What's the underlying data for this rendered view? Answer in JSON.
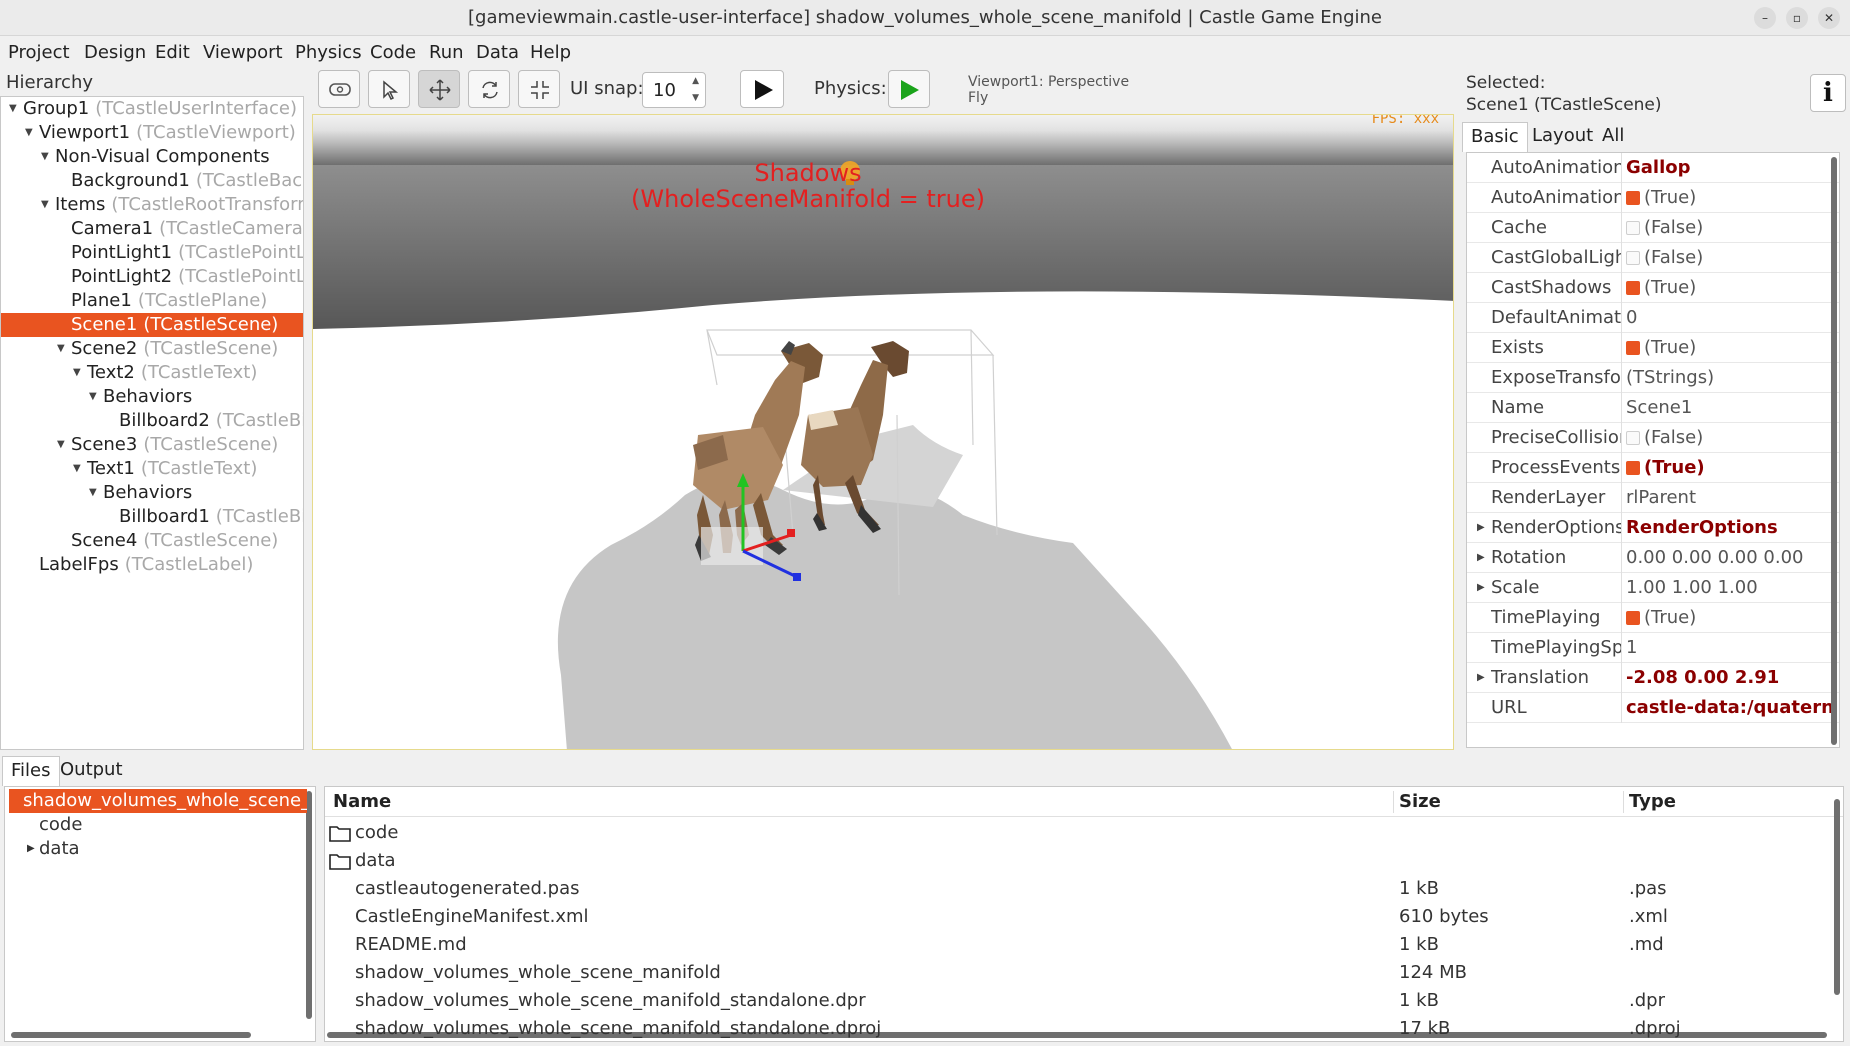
{
  "window": {
    "title": "[gameviewmain.castle-user-interface] shadow_volumes_whole_scene_manifold | Castle Game Engine",
    "btn_min": "–",
    "btn_max": "▫",
    "btn_close": "✕"
  },
  "menu": [
    "Project",
    "Design",
    "Edit",
    "Viewport",
    "Physics",
    "Code",
    "Run",
    "Data",
    "Help"
  ],
  "hierarchy": {
    "label": "Hierarchy",
    "items": [
      {
        "name": "Group1",
        "cls": "(TCastleUserInterface)",
        "depth": 0,
        "expand": "open"
      },
      {
        "name": "Viewport1",
        "cls": "(TCastleViewport)",
        "depth": 1,
        "expand": "open"
      },
      {
        "name": "Non-Visual Components",
        "cls": "",
        "depth": 2,
        "expand": "open"
      },
      {
        "name": "Background1",
        "cls": "(TCastleBackground)",
        "depth": 3,
        "expand": "none"
      },
      {
        "name": "Items",
        "cls": "(TCastleRootTransform)",
        "depth": 2,
        "expand": "open"
      },
      {
        "name": "Camera1",
        "cls": "(TCastleCamera)",
        "depth": 3,
        "expand": "none"
      },
      {
        "name": "PointLight1",
        "cls": "(TCastlePointLight)",
        "depth": 3,
        "expand": "none"
      },
      {
        "name": "PointLight2",
        "cls": "(TCastlePointLight)",
        "depth": 3,
        "expand": "none"
      },
      {
        "name": "Plane1",
        "cls": "(TCastlePlane)",
        "depth": 3,
        "expand": "none"
      },
      {
        "name": "Scene1",
        "cls": "(TCastleScene)",
        "depth": 3,
        "expand": "none",
        "selected": true
      },
      {
        "name": "Scene2",
        "cls": "(TCastleScene)",
        "depth": 3,
        "expand": "open"
      },
      {
        "name": "Text2",
        "cls": "(TCastleText)",
        "depth": 4,
        "expand": "open"
      },
      {
        "name": "Behaviors",
        "cls": "",
        "depth": 5,
        "expand": "open"
      },
      {
        "name": "Billboard2",
        "cls": "(TCastleBillboard)",
        "depth": 6,
        "expand": "none"
      },
      {
        "name": "Scene3",
        "cls": "(TCastleScene)",
        "depth": 3,
        "expand": "open"
      },
      {
        "name": "Text1",
        "cls": "(TCastleText)",
        "depth": 4,
        "expand": "open"
      },
      {
        "name": "Behaviors",
        "cls": "",
        "depth": 5,
        "expand": "open"
      },
      {
        "name": "Billboard1",
        "cls": "(TCastleBillboard)",
        "depth": 6,
        "expand": "none"
      },
      {
        "name": "Scene4",
        "cls": "(TCastleScene)",
        "depth": 3,
        "expand": "none"
      },
      {
        "name": "LabelFps",
        "cls": "(TCastleLabel)",
        "depth": 1,
        "expand": "none"
      }
    ]
  },
  "toolbar": {
    "ui_snap_label": "UI snap:",
    "ui_snap_value": "10",
    "physics_label": "Physics:",
    "viewport_info_line1": "Viewport1: Perspective",
    "viewport_info_line2": "Fly"
  },
  "viewport": {
    "fps": "FPS: xxx",
    "text_line1": "Shadows",
    "text_line2": "(WholeSceneManifold  = true)"
  },
  "inspector": {
    "selected_label": "Selected:",
    "selected_value": "Scene1 (TCastleScene)",
    "info_button": "i",
    "tabs": [
      "Basic",
      "Layout",
      "All"
    ],
    "properties": [
      {
        "name": "AutoAnimation",
        "value": "Gallop",
        "bold": true,
        "check": "",
        "expand": false
      },
      {
        "name": "AutoAnimationLoop",
        "value": "(True)",
        "bold": false,
        "check": "on",
        "expand": false
      },
      {
        "name": "Cache",
        "value": "(False)",
        "bold": false,
        "check": "off",
        "expand": false
      },
      {
        "name": "CastGlobalLights",
        "value": "(False)",
        "bold": false,
        "check": "off",
        "expand": false
      },
      {
        "name": "CastShadows",
        "value": "(True)",
        "bold": false,
        "check": "on",
        "expand": false
      },
      {
        "name": "DefaultAnimationTransition",
        "value": "0",
        "bold": false,
        "check": "",
        "expand": false
      },
      {
        "name": "Exists",
        "value": "(True)",
        "bold": false,
        "check": "on",
        "expand": false
      },
      {
        "name": "ExposeTransforms",
        "value": "(TStrings)",
        "bold": false,
        "check": "",
        "expand": false
      },
      {
        "name": "Name",
        "value": "Scene1",
        "bold": false,
        "check": "",
        "expand": false
      },
      {
        "name": "PreciseCollisions",
        "value": "(False)",
        "bold": false,
        "check": "off",
        "expand": false
      },
      {
        "name": "ProcessEvents",
        "value": "(True)",
        "bold": true,
        "check": "on",
        "expand": false
      },
      {
        "name": "RenderLayer",
        "value": "rlParent",
        "bold": false,
        "check": "",
        "expand": false
      },
      {
        "name": "RenderOptions",
        "value": "RenderOptions",
        "bold": true,
        "check": "",
        "expand": true
      },
      {
        "name": "Rotation",
        "value": "0.00 0.00 0.00 0.00",
        "bold": false,
        "check": "",
        "expand": true
      },
      {
        "name": "Scale",
        "value": "1.00 1.00 1.00",
        "bold": false,
        "check": "",
        "expand": true
      },
      {
        "name": "TimePlaying",
        "value": "(True)",
        "bold": false,
        "check": "on",
        "expand": false
      },
      {
        "name": "TimePlayingSpeed",
        "value": "1",
        "bold": false,
        "check": "",
        "expand": false
      },
      {
        "name": "Translation",
        "value": "-2.08 0.00 2.91",
        "bold": true,
        "check": "",
        "expand": true
      },
      {
        "name": "URL",
        "value": "castle-data:/quaternius_",
        "bold": true,
        "check": "",
        "expand": false
      }
    ]
  },
  "bottom": {
    "tabs": [
      "Files",
      "Output"
    ],
    "tree": [
      {
        "name": "shadow_volumes_whole_scene_manifold",
        "depth": 0,
        "selected": true,
        "expand": "none"
      },
      {
        "name": "code",
        "depth": 1,
        "selected": false,
        "expand": "none"
      },
      {
        "name": "data",
        "depth": 1,
        "selected": false,
        "expand": "closed"
      }
    ],
    "columns": [
      "Name",
      "Size",
      "Type"
    ],
    "files": [
      {
        "name": "code",
        "size": "",
        "type": "",
        "folder": true
      },
      {
        "name": "data",
        "size": "",
        "type": "",
        "folder": true
      },
      {
        "name": "castleautogenerated.pas",
        "size": "1 kB",
        "type": ".pas",
        "folder": false
      },
      {
        "name": "CastleEngineManifest.xml",
        "size": "610 bytes",
        "type": ".xml",
        "folder": false
      },
      {
        "name": "README.md",
        "size": "1 kB",
        "type": ".md",
        "folder": false
      },
      {
        "name": "shadow_volumes_whole_scene_manifold",
        "size": "124 MB",
        "type": "",
        "folder": false
      },
      {
        "name": "shadow_volumes_whole_scene_manifold_standalone.dpr",
        "size": "1 kB",
        "type": ".dpr",
        "folder": false
      },
      {
        "name": "shadow_volumes_whole_scene_manifold_standalone.dproj",
        "size": "17 kB",
        "type": ".dproj",
        "folder": false
      }
    ]
  },
  "colors": {
    "accent": "#e95420",
    "bold_value": "#8b0000",
    "play_green": "#1aa31a"
  }
}
